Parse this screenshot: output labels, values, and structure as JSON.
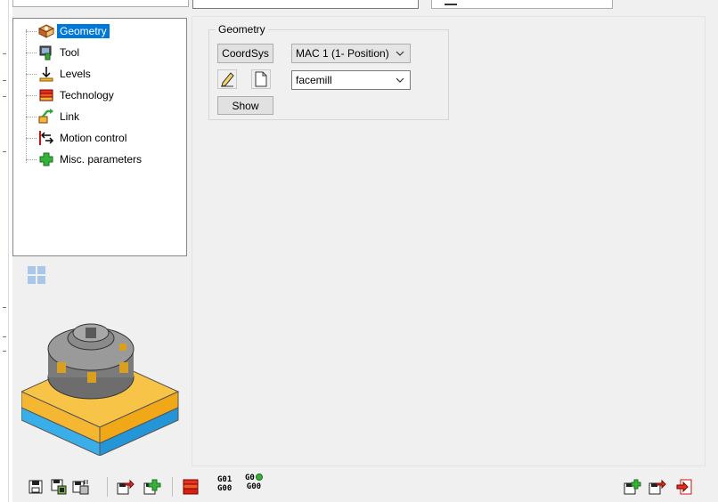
{
  "tree": {
    "items": [
      {
        "label": "Geometry",
        "icon": "geometry-icon",
        "selected": true
      },
      {
        "label": "Tool",
        "icon": "tool-icon",
        "selected": false
      },
      {
        "label": "Levels",
        "icon": "levels-icon",
        "selected": false
      },
      {
        "label": "Technology",
        "icon": "technology-icon",
        "selected": false
      },
      {
        "label": "Link",
        "icon": "link-icon",
        "selected": false
      },
      {
        "label": "Motion control",
        "icon": "motion-control-icon",
        "selected": false
      },
      {
        "label": "Misc. parameters",
        "icon": "misc-parameters-icon",
        "selected": false
      }
    ]
  },
  "geometry": {
    "group_title": "Geometry",
    "coordsys_label": "CoordSys",
    "coordsys_value": "MAC 1 (1- Position)",
    "geometry_value": "facemill",
    "show_label": "Show"
  },
  "toolbar": {
    "g01": "G01",
    "g00a": "G00",
    "g0": "G0",
    "g00b": "G00"
  },
  "colors": {
    "selection": "#0078d7",
    "panel_bg": "#f0f0f0",
    "stock_top": "#f5b731",
    "stock_bottom": "#3aaee8"
  }
}
